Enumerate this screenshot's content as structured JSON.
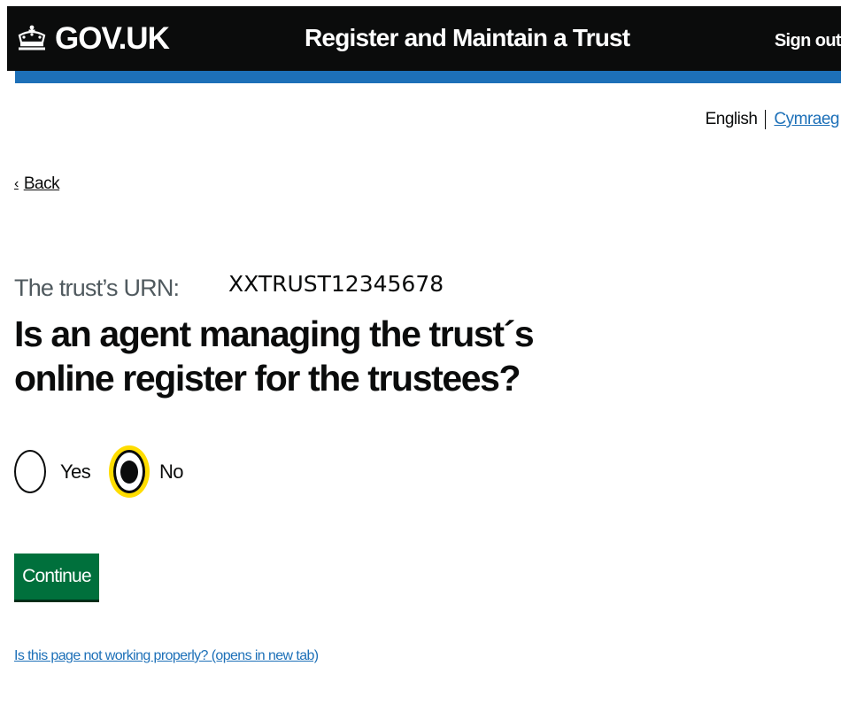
{
  "header": {
    "logo_text": "GOV.UK",
    "service_name": "Register and Maintain a Trust",
    "sign_out_label": "Sign out"
  },
  "language": {
    "english": "English",
    "welsh": "Cymraeg"
  },
  "back_label": "Back",
  "form": {
    "caption": "The trust’s URN:",
    "urn_value": "XXTRUST12345678",
    "heading": "Is an agent managing the trust´s online register for the trustees?",
    "options": [
      {
        "label": "Yes",
        "checked": false
      },
      {
        "label": "No",
        "checked": true
      }
    ],
    "continue_label": "Continue"
  },
  "report_link": "Is this page not working properly? (opens in new tab)",
  "colors": {
    "header_bg": "#0b0c0c",
    "header_bar": "#1d70b8",
    "button_green": "#00703c",
    "focus_yellow": "#ffdd00",
    "link_blue": "#1d70b8"
  },
  "icons": {
    "logo": "crown-icon",
    "back": "chevron-left-icon"
  }
}
